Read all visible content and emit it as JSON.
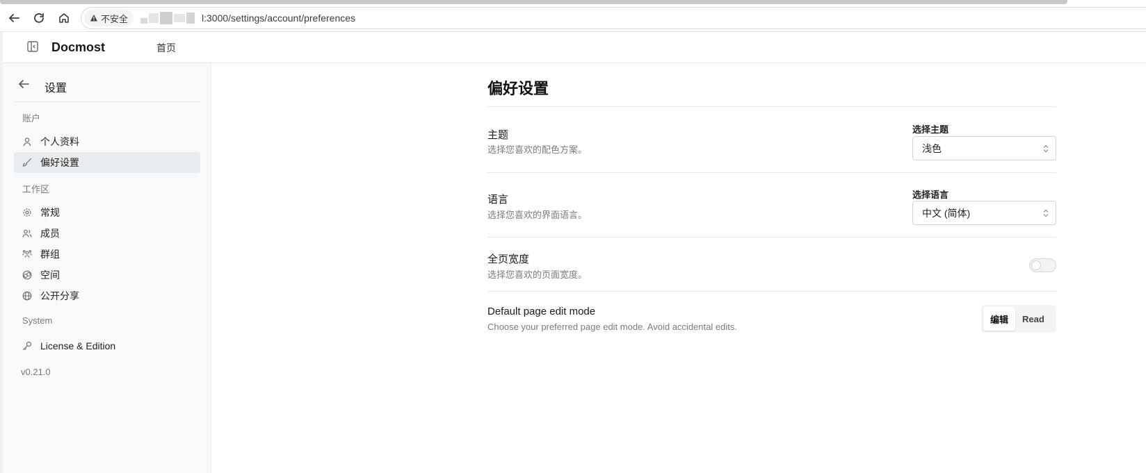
{
  "browser": {
    "security_label": "不安全",
    "url": "l:3000/settings/account/preferences"
  },
  "header": {
    "brand": "Docmost",
    "home_link": "首页"
  },
  "sidebar": {
    "title": "设置",
    "sections": {
      "account": "账户",
      "workspace": "工作区",
      "system": "System"
    },
    "items": {
      "profile": "个人资料",
      "preferences": "偏好设置",
      "general": "常规",
      "members": "成员",
      "groups": "群组",
      "spaces": "空间",
      "public_sharing": "公开分享",
      "license": "License & Edition"
    },
    "version": "v0.21.0"
  },
  "main": {
    "title": "偏好设置",
    "theme": {
      "label": "主题",
      "description": "选择您喜欢的配色方案。",
      "select_label": "选择主题",
      "value": "浅色"
    },
    "language": {
      "label": "语言",
      "description": "选择您喜欢的界面语言。",
      "select_label": "选择语言",
      "value": "中文 (简体)"
    },
    "full_width": {
      "label": "全页宽度",
      "description": "选择您喜欢的页面宽度。",
      "enabled": false
    },
    "edit_mode": {
      "label": "Default page edit mode",
      "description": "Choose your preferred page edit mode. Avoid accidental edits.",
      "options": [
        "编辑",
        "Read"
      ],
      "selected": "编辑"
    }
  }
}
